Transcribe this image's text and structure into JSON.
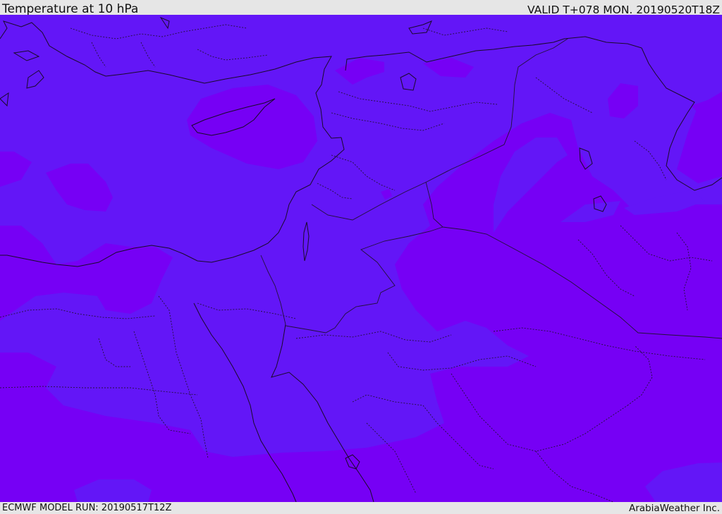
{
  "header": {
    "title": "Temperature at 10 hPa",
    "valid_time": "VALID T+078 MON. 20190520T18Z"
  },
  "footer": {
    "model_run": "ECMWF MODEL RUN: 20190517T12Z",
    "credit": "ArabiaWeather Inc."
  },
  "map": {
    "colors": {
      "field_warm": "#7600f5",
      "field_cool": "#6316f7",
      "coastline": "#1a0a2a",
      "border": "#23103a"
    }
  }
}
